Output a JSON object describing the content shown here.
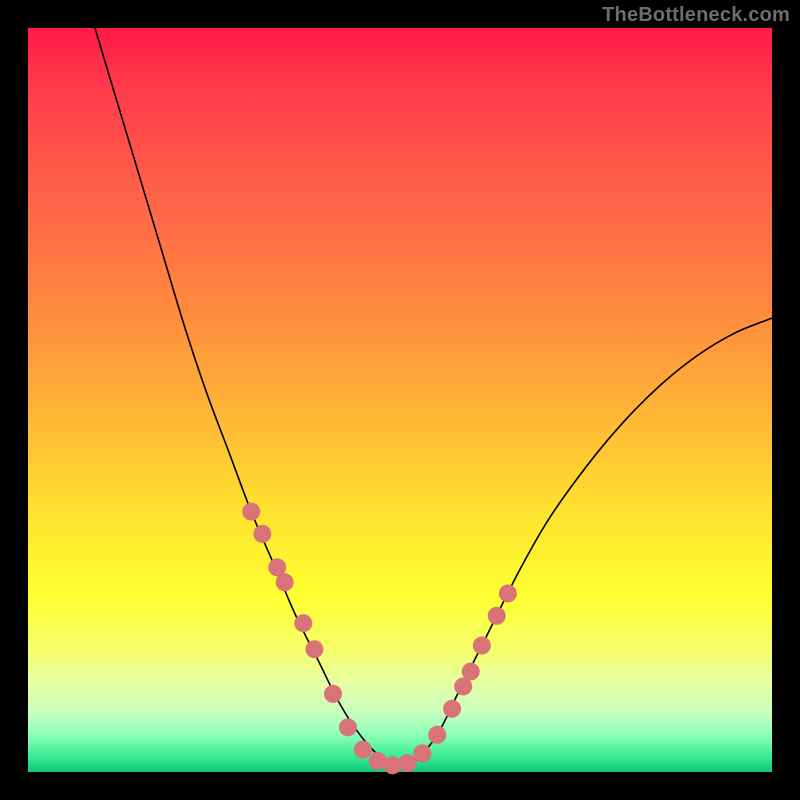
{
  "watermark": "TheBottleneck.com",
  "colors": {
    "background": "#000000",
    "marker": "#d97279",
    "curve": "#000000",
    "gradient_top": "#ff1a47",
    "gradient_bottom": "#12c477"
  },
  "chart_data": {
    "type": "line",
    "title": "",
    "xlabel": "",
    "ylabel": "",
    "xlim": [
      0,
      100
    ],
    "ylim": [
      0,
      100
    ],
    "series": [
      {
        "name": "bottleneck-curve",
        "x": [
          9,
          12,
          15,
          18,
          21,
          24,
          27,
          30,
          33,
          36,
          39,
          42,
          45,
          48,
          50,
          52,
          55,
          58,
          62,
          66,
          70,
          75,
          80,
          85,
          90,
          95,
          100
        ],
        "values": [
          100,
          90,
          80,
          70,
          60,
          51,
          43,
          35,
          28,
          21,
          15,
          9,
          4.5,
          1.5,
          0.8,
          1.5,
          5,
          11,
          19,
          27,
          34,
          41,
          47,
          52,
          56,
          59,
          61
        ]
      }
    ],
    "markers": {
      "name": "highlighted-points",
      "x": [
        30,
        31.5,
        33.5,
        34.5,
        37,
        38.5,
        41,
        43,
        45,
        47,
        49,
        51,
        53,
        55,
        57,
        58.5,
        59.5,
        61,
        63,
        64.5
      ],
      "values": [
        35,
        32,
        27.5,
        25.5,
        20,
        16.5,
        10.5,
        6,
        3,
        1.5,
        0.9,
        1.2,
        2.5,
        5,
        8.5,
        11.5,
        13.5,
        17,
        21,
        24
      ]
    }
  }
}
